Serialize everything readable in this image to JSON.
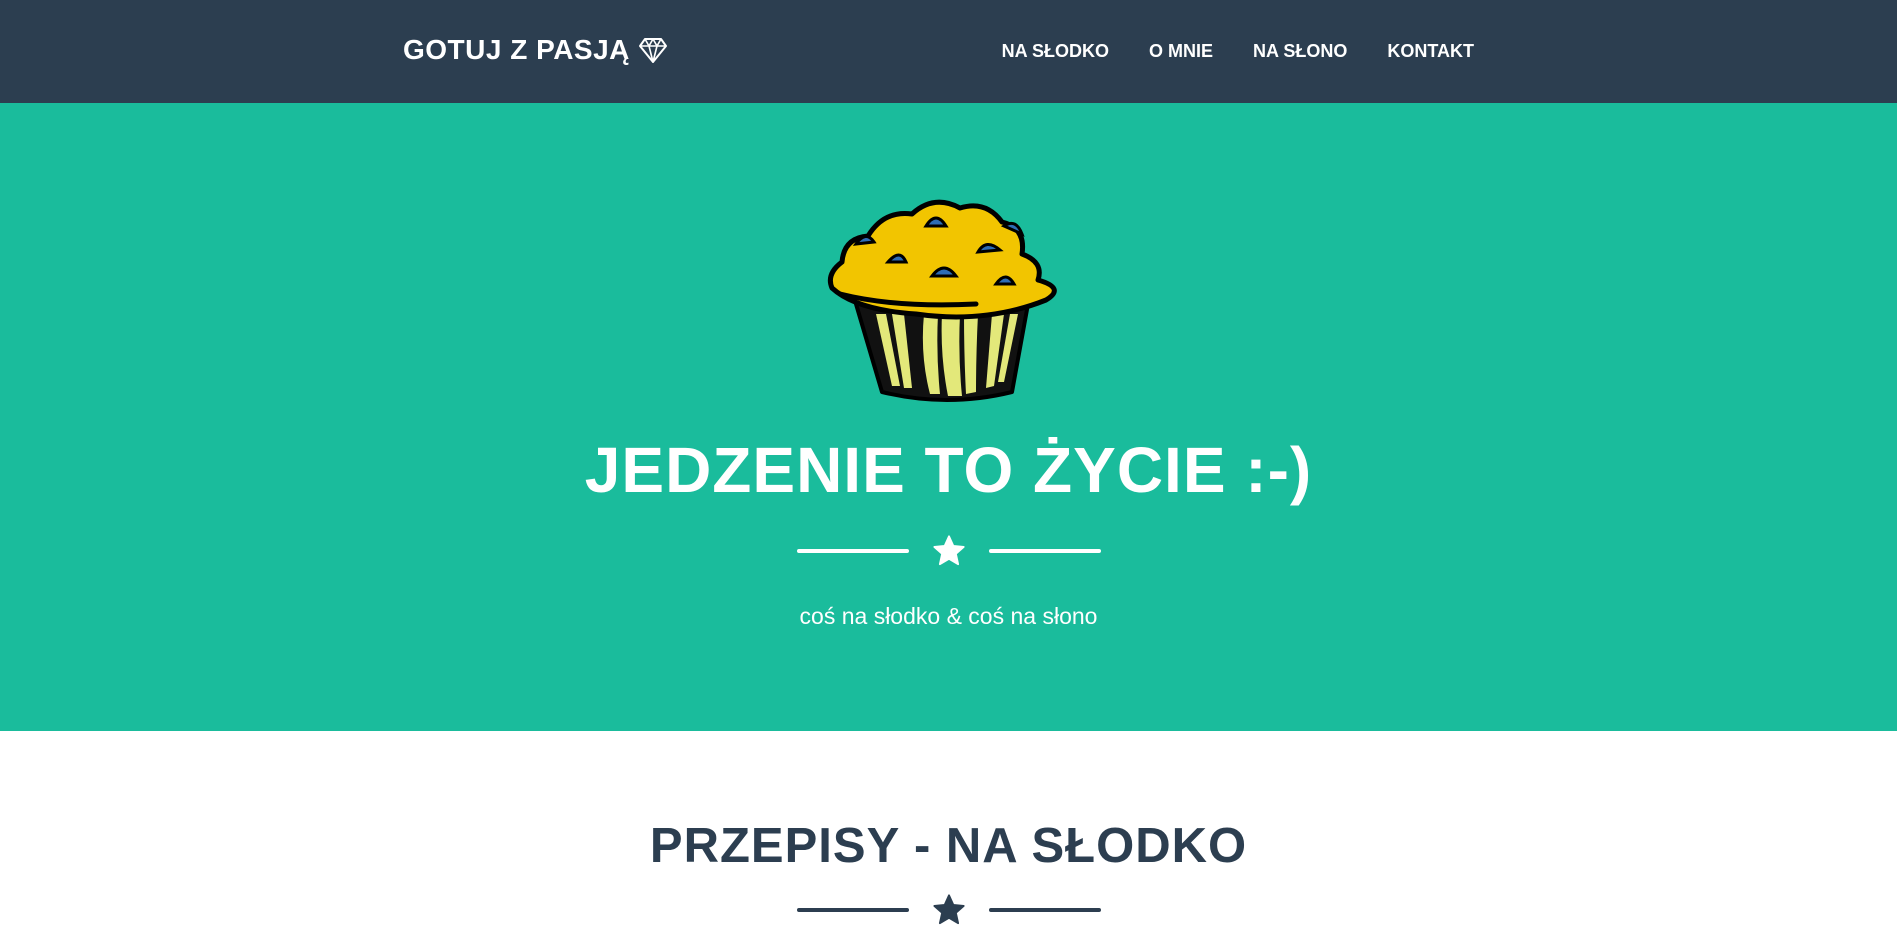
{
  "navbar": {
    "brand": "GOTUJ Z PASJĄ",
    "brand_icon": "diamond-icon",
    "links": [
      "NA SŁODKO",
      "O MNIE",
      "NA SŁONO",
      "KONTAKT"
    ]
  },
  "hero": {
    "image": "muffin-illustration",
    "title": "JEDZENIE TO ŻYCIE :-)",
    "divider_icon": "star-icon",
    "subtitle": "coś na słodko & coś na słono"
  },
  "section": {
    "title": "PRZEPISY - NA SŁODKO",
    "divider_icon": "star-icon"
  },
  "colors": {
    "navbar": "#2c3e50",
    "hero": "#1abc9c",
    "text_light": "#ffffff",
    "text_dark": "#2c3e50",
    "muffin_top": "#f2c500",
    "muffin_wrapper": "#e3e87a",
    "blueberry": "#2f6db5"
  }
}
